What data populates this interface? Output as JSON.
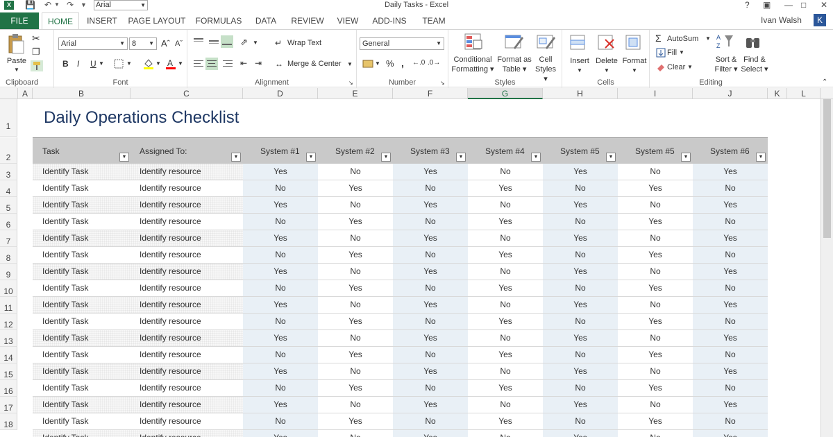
{
  "titlebar": {
    "font_name": "Arial",
    "title": "Daily Tasks - Excel",
    "help": "?",
    "window_controls": [
      "?",
      "▣",
      "─",
      "▢",
      "✕"
    ]
  },
  "tabs": {
    "file": "FILE",
    "items": [
      "HOME",
      "INSERT",
      "PAGE LAYOUT",
      "FORMULAS",
      "DATA",
      "REVIEW",
      "VIEW",
      "ADD-INS",
      "TEAM"
    ],
    "active": "HOME",
    "user": "Ivan Walsh",
    "avatar": "K"
  },
  "ribbon": {
    "clipboard": {
      "paste": "Paste",
      "label": "Clipboard"
    },
    "font": {
      "name": "Arial",
      "size": "8",
      "bold": "B",
      "italic": "I",
      "underline": "U",
      "label": "Font"
    },
    "alignment": {
      "wrap_text": "Wrap Text",
      "merge_center": "Merge & Center",
      "label": "Alignment"
    },
    "number": {
      "format": "General",
      "percent": "%",
      "comma": ",",
      "label": "Number"
    },
    "styles": {
      "conditional_1": "Conditional",
      "conditional_2": "Formatting",
      "format_table_1": "Format as",
      "format_table_2": "Table",
      "cell_styles_1": "Cell",
      "cell_styles_2": "Styles",
      "label": "Styles"
    },
    "cells": {
      "insert": "Insert",
      "delete": "Delete",
      "format": "Format",
      "label": "Cells"
    },
    "editing": {
      "autosum": "AutoSum",
      "fill": "Fill",
      "clear": "Clear",
      "sort_1": "Sort &",
      "sort_2": "Filter",
      "find_1": "Find &",
      "find_2": "Select",
      "label": "Editing"
    }
  },
  "columns": [
    "A",
    "B",
    "C",
    "D",
    "E",
    "F",
    "G",
    "H",
    "I",
    "J",
    "K",
    "L"
  ],
  "selected_column": "G",
  "rows": [
    "1",
    "2",
    "3",
    "4",
    "5",
    "6",
    "7",
    "8",
    "9",
    "10",
    "11",
    "12",
    "13",
    "14",
    "15",
    "16",
    "17",
    "18"
  ],
  "sheet": {
    "title": "Daily Operations Checklist",
    "headers": [
      "Task",
      "Assigned To:",
      "System #1",
      "System #2",
      "System #3",
      "System #4",
      "System #5",
      "System #5",
      "System #6"
    ],
    "task": "Identify Task",
    "resource": "Identify resource",
    "pattern_a": [
      "Yes",
      "No",
      "Yes",
      "No",
      "Yes",
      "No",
      "Yes"
    ],
    "pattern_b": [
      "No",
      "Yes",
      "No",
      "Yes",
      "No",
      "Yes",
      "No"
    ],
    "partial_row": [
      "Identify Task",
      "Identify resource",
      "Yes",
      "No",
      "Yes",
      "No",
      "Yes",
      "No",
      "Yes"
    ]
  }
}
